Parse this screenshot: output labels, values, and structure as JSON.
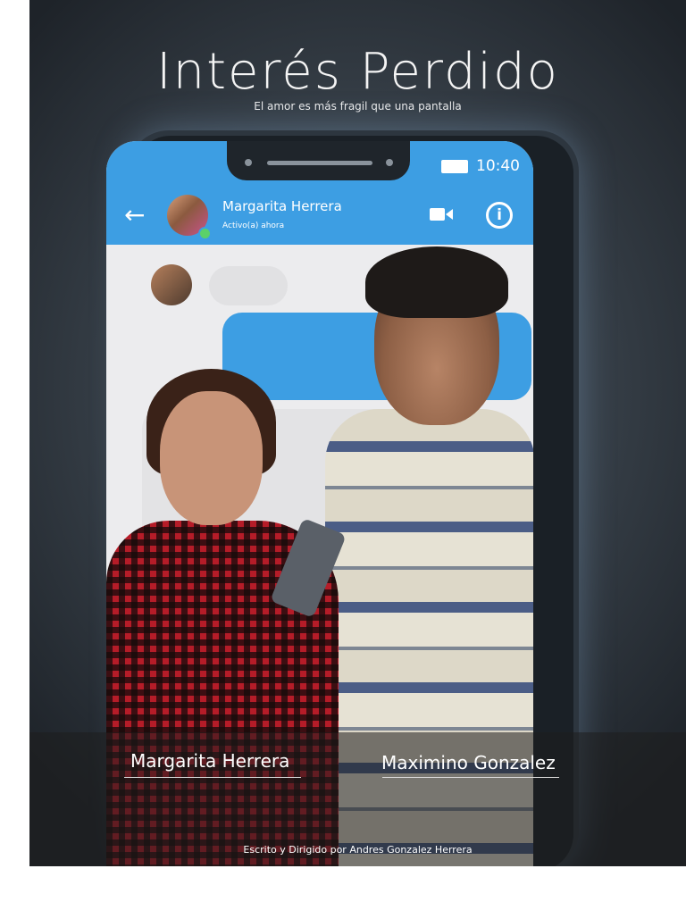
{
  "poster": {
    "title": "Interés Perdido",
    "tagline": "El amor es más fragil que una pantalla",
    "credit": "Escrito y Dirigido por Andres Gonzalez Herrera"
  },
  "phone": {
    "status_time": "10:40",
    "chat": {
      "back_icon": "arrow-left-icon",
      "contact_name": "Margarita Herrera",
      "contact_status": "Activo(a) ahora",
      "video_icon": "video-camera-icon",
      "info_icon": "info-icon"
    }
  },
  "cast": [
    "Margarita Herrera",
    "Maximino Gonzalez"
  ],
  "colors": {
    "accent": "#3d9ee3",
    "background": "#2d363f"
  }
}
